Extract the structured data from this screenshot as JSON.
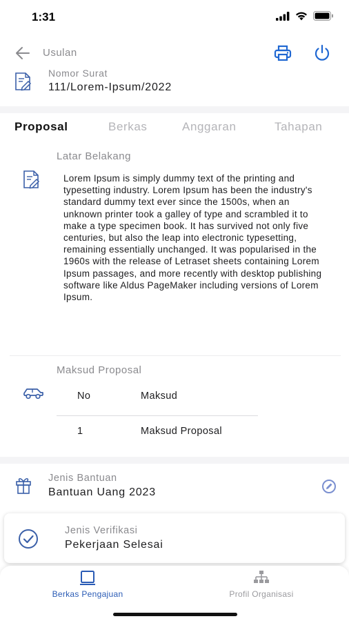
{
  "status_bar": {
    "time": "1:31"
  },
  "header": {
    "title": "Usulan",
    "back_icon": "arrow-left-icon",
    "print_icon": "printer-icon",
    "power_icon": "power-icon",
    "accent": "#1f67d2"
  },
  "nomor_surat": {
    "label": "Nomor Surat",
    "value": "111/Lorem-Ipsum/2022"
  },
  "tabs": [
    {
      "label": "Proposal",
      "active": true
    },
    {
      "label": "Berkas",
      "active": false
    },
    {
      "label": "Anggaran",
      "active": false
    },
    {
      "label": "Tahapan",
      "active": false
    }
  ],
  "latar_belakang": {
    "label": "Latar Belakang",
    "text": "Lorem Ipsum is simply dummy text of the printing and typesetting industry. Lorem Ipsum has been the industry's standard dummy text ever since the 1500s, when an unknown printer took a galley of type and scrambled it to make a type specimen book. It has survived not only five centuries, but also the leap into electronic typesetting, remaining essentially unchanged. It was popularised in the 1960s with the release of Letraset sheets containing Lorem Ipsum passages, and more recently with desktop publishing software like Aldus PageMaker including versions of Lorem Ipsum."
  },
  "maksud_proposal": {
    "label": "Maksud Proposal",
    "columns": [
      "No",
      "Maksud"
    ],
    "rows": [
      {
        "no": "1",
        "maksud": "Maksud Proposal"
      }
    ]
  },
  "jenis_bantuan": {
    "label": "Jenis Bantuan",
    "value": "Bantuan Uang 2023"
  },
  "jenis_verifikasi": {
    "label": "Jenis Verifikasi",
    "value": "Pekerjaan Selesai"
  },
  "bottom_nav": [
    {
      "label": "Berkas Pengajuan",
      "active": true,
      "icon": "folder-icon"
    },
    {
      "label": "Profil Organisasi",
      "active": false,
      "icon": "org-chart-icon"
    }
  ],
  "colors": {
    "accent": "#1f67d2",
    "nav_active": "#2a5bb5",
    "muted": "#8a8a8e",
    "icon_blue": "#3a5fa8"
  }
}
